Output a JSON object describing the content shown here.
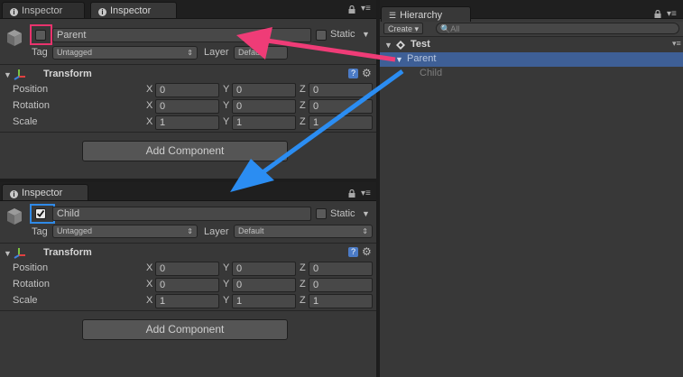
{
  "colors": {
    "panel": "#383838",
    "selection": "#3e5f96",
    "highlight_pink": "#e8336d",
    "highlight_blue": "#2f8ae8",
    "arrow_pink": "#ef3c77",
    "arrow_blue": "#2b8df2"
  },
  "inspector_top": {
    "tabs": [
      "Inspector",
      "Inspector"
    ],
    "object_active": false,
    "object_name": "Parent",
    "static_label": "Static",
    "tag_label": "Tag",
    "tag_value": "Untagged",
    "layer_label": "Layer",
    "layer_value": "Default",
    "component_title": "Transform",
    "rows": [
      {
        "label": "Position",
        "x": "0",
        "y": "0",
        "z": "0"
      },
      {
        "label": "Rotation",
        "x": "0",
        "y": "0",
        "z": "0"
      },
      {
        "label": "Scale",
        "x": "1",
        "y": "1",
        "z": "1"
      }
    ],
    "add_component": "Add Component"
  },
  "inspector_bottom": {
    "tabs": [
      "Inspector"
    ],
    "object_active": true,
    "object_name": "Child",
    "static_label": "Static",
    "tag_label": "Tag",
    "tag_value": "Untagged",
    "layer_label": "Layer",
    "layer_value": "Default",
    "component_title": "Transform",
    "rows": [
      {
        "label": "Position",
        "x": "0",
        "y": "0",
        "z": "0"
      },
      {
        "label": "Rotation",
        "x": "0",
        "y": "0",
        "z": "0"
      },
      {
        "label": "Scale",
        "x": "1",
        "y": "1",
        "z": "1"
      }
    ],
    "add_component": "Add Component"
  },
  "axis_labels": {
    "x": "X",
    "y": "Y",
    "z": "Z"
  },
  "hierarchy": {
    "tab": "Hierarchy",
    "create_label": "Create",
    "search_placeholder": "All",
    "scene_name": "Test",
    "items": [
      "Parent",
      "Child"
    ]
  },
  "icons": [
    "info-icon",
    "lock-icon",
    "panel-menu-icon",
    "gameobject-cube-icon",
    "transform-axes-icon",
    "help-icon",
    "gear-icon",
    "unity-scene-icon",
    "search-icon"
  ]
}
